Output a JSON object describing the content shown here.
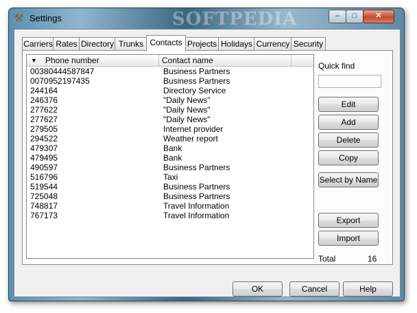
{
  "window": {
    "title": "Settings",
    "watermark": "SOFTPEDIA",
    "controls": {
      "minimize": "–",
      "maximize": "□",
      "close": "✕"
    }
  },
  "tabs": [
    {
      "label": "Carriers",
      "active": false
    },
    {
      "label": "Rates",
      "active": false
    },
    {
      "label": "Directory",
      "active": false
    },
    {
      "label": "Trunks",
      "active": false
    },
    {
      "label": "Contacts",
      "active": true
    },
    {
      "label": "Projects",
      "active": false
    },
    {
      "label": "Holidays",
      "active": false
    },
    {
      "label": "Currency",
      "active": false
    },
    {
      "label": "Security",
      "active": false
    }
  ],
  "contacts_table": {
    "columns": [
      "Phone number",
      "Contact name"
    ],
    "sort_indicator": "▼",
    "rows": [
      {
        "phone": "00380444587847",
        "name": "Business Partners"
      },
      {
        "phone": "0070952197435",
        "name": "Business Partners"
      },
      {
        "phone": "244164",
        "name": "Directory Service"
      },
      {
        "phone": "246376",
        "name": "\"Daily News\""
      },
      {
        "phone": "277622",
        "name": "\"Daily News\""
      },
      {
        "phone": "277627",
        "name": "\"Daily News\""
      },
      {
        "phone": "279505",
        "name": "Internet provider"
      },
      {
        "phone": "294522",
        "name": "Weather report"
      },
      {
        "phone": "479307",
        "name": "Bank"
      },
      {
        "phone": "479495",
        "name": "Bank"
      },
      {
        "phone": "490597",
        "name": "Business Partners"
      },
      {
        "phone": "516796",
        "name": "Taxi"
      },
      {
        "phone": "519544",
        "name": "Business Partners"
      },
      {
        "phone": "725048",
        "name": "Business Partners"
      },
      {
        "phone": "748817",
        "name": "Travel Information"
      },
      {
        "phone": "767173",
        "name": "Travel Information"
      }
    ]
  },
  "sidebar": {
    "quick_find_label": "Quick find",
    "quick_find_value": "",
    "buttons": {
      "edit": "Edit",
      "add": "Add",
      "delete": "Delete",
      "copy": "Copy",
      "select_by_name": "Select by Name",
      "export": "Export",
      "import": "Import"
    },
    "total_label": "Total",
    "total_value": "16"
  },
  "footer": {
    "ok": "OK",
    "cancel": "Cancel",
    "help": "Help"
  },
  "colors": {
    "active_tab": "#fcfcfc",
    "dialog_bg": "#f0f0f0",
    "close_button": "#c14a2f"
  }
}
